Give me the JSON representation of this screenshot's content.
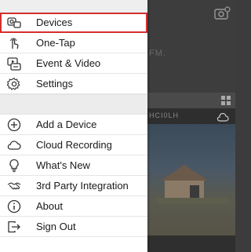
{
  "menu": {
    "primary": [
      {
        "label": "Devices",
        "icon": "devices-icon",
        "selected": true
      },
      {
        "label": "One-Tap",
        "icon": "tap-icon"
      },
      {
        "label": "Event & Video",
        "icon": "event-video-icon"
      },
      {
        "label": "Settings",
        "icon": "gear-icon"
      }
    ],
    "secondary": [
      {
        "label": "Add a Device",
        "icon": "plus-circle-icon"
      },
      {
        "label": "Cloud Recording",
        "icon": "cloud-icon"
      },
      {
        "label": "What's New",
        "icon": "lightbulb-icon"
      },
      {
        "label": "3rd Party Integration",
        "icon": "handshake-icon"
      },
      {
        "label": "About",
        "icon": "info-icon"
      },
      {
        "label": "Sign Out",
        "icon": "sign-out-icon"
      }
    ]
  },
  "background": {
    "faint_text": "FM.",
    "camera_title": "HCI0LH"
  },
  "colors": {
    "selected_outline": "#d32f2f",
    "drawer_bg": "#ffffff",
    "separator_bg": "#ececec"
  }
}
